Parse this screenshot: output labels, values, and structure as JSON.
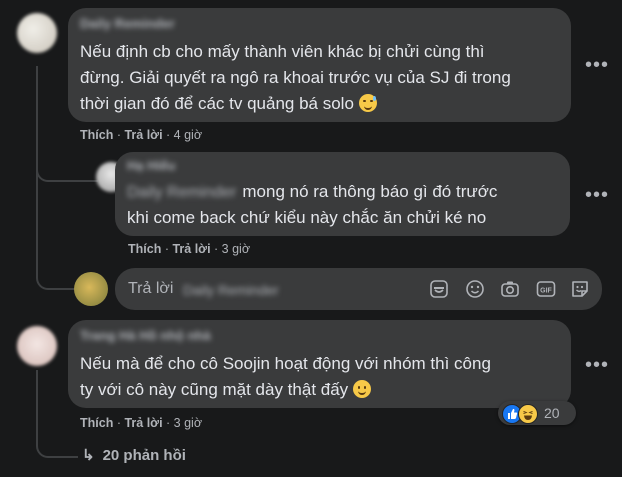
{
  "comment1": {
    "author": "Daily Reminder",
    "lines": [
      "Nếu định cb cho mấy thành viên khác bị chửi cùng thì",
      "đừng. Giải quyết ra ngô ra khoai trước vụ của SJ đi trong",
      "thời gian đó để các tv quảng bá solo"
    ],
    "like": "Thích",
    "reply": "Trả lời",
    "time": "4 giờ"
  },
  "reply1": {
    "author": "Hạ Hiếu",
    "mention": "Daily Reminder",
    "line1_rest": "mong nó ra thông báo gì đó trước",
    "line2": "khi come back chứ kiểu này chắc ăn chửi ké no",
    "like": "Thích",
    "reply": "Trả lời",
    "time": "3 giờ"
  },
  "reply_input": {
    "placeholder": "Trả lời",
    "mention": "Daily Reminder",
    "icons": [
      "sticker-icon",
      "emoji-icon",
      "camera-icon",
      "gif-icon",
      "sticker-face-icon"
    ],
    "gif_label": "GIF"
  },
  "comment2": {
    "author": "Trang Hà Hồ nhộ nhà",
    "lines": [
      "Nếu mà để cho cô Soojin hoạt động với nhóm thì công",
      "ty với cô này cũng mặt dày thật đấy"
    ],
    "like": "Thích",
    "reply": "Trả lời",
    "time": "3 giờ",
    "reaction_count": "20"
  },
  "view_replies": "20 phản hồi",
  "colors": {
    "background": "#18191a",
    "bubble": "#3a3b3c",
    "text": "#e4e6eb",
    "secondary": "#b0b3b8",
    "like_blue": "#1877f2",
    "emoji_yellow": "#f7c948"
  }
}
